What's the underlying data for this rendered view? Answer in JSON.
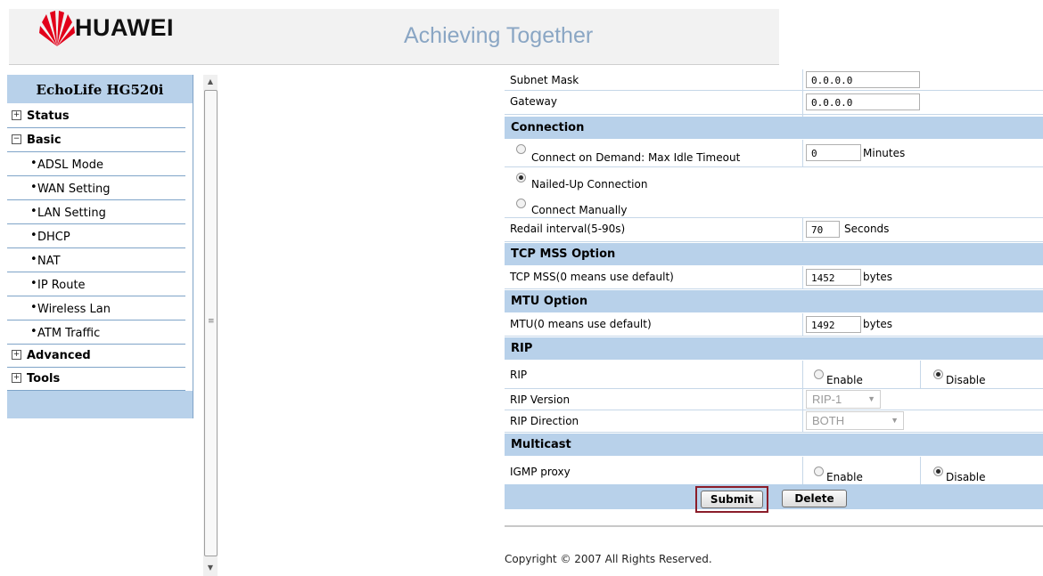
{
  "header": {
    "brand": "HUAWEI",
    "slogan": "Achieving Together"
  },
  "sidebar": {
    "title": "EchoLife HG520i",
    "items": [
      {
        "label": "Status",
        "toggle": "+"
      },
      {
        "label": "Basic",
        "toggle": "−"
      },
      {
        "label": "Advanced",
        "toggle": "+"
      },
      {
        "label": "Tools",
        "toggle": "+"
      }
    ],
    "subitems": [
      "ADSL Mode",
      "WAN Setting",
      "LAN Setting",
      "DHCP",
      "NAT",
      "IP Route",
      "Wireless Lan",
      "ATM Traffic"
    ],
    "bullet": "•"
  },
  "scrollbar": {
    "up": "▲",
    "down": "▼",
    "grip": "≡"
  },
  "form": {
    "subnet_mask": {
      "label": "Subnet Mask",
      "value": "0.0.0.0"
    },
    "gateway": {
      "label": "Gateway",
      "value": "0.0.0.0"
    },
    "connection": {
      "heading": "Connection",
      "on_demand": {
        "label": "Connect on Demand: Max Idle Timeout",
        "value": "0",
        "unit": "Minutes"
      },
      "nailed_up": "Nailed-Up Connection",
      "manual": "Connect Manually",
      "selected": "Nailed-Up Connection",
      "redial": {
        "label": "Redail interval(5-90s)",
        "value": "70",
        "unit": "Seconds"
      }
    },
    "tcp_mss": {
      "heading": "TCP MSS Option",
      "label": "TCP MSS(0 means use default)",
      "value": "1452",
      "unit": "bytes"
    },
    "mtu": {
      "heading": "MTU Option",
      "label": "MTU(0 means use default)",
      "value": "1492",
      "unit": "bytes"
    },
    "rip": {
      "heading": "RIP",
      "label": "RIP",
      "enable": "Enable",
      "disable": "Disable",
      "selected": "Disable",
      "version_label": "RIP Version",
      "version_value": "RIP-1",
      "direction_label": "RIP Direction",
      "direction_value": "BOTH",
      "dropdown_arrow": "▼"
    },
    "multicast": {
      "heading": "Multicast",
      "label": "IGMP proxy",
      "enable": "Enable",
      "disable": "Disable",
      "selected": "Disable"
    },
    "buttons": {
      "submit": "Submit",
      "delete": "Delete"
    }
  },
  "footer": {
    "copyright": "Copyright © 2007 All Rights Reserved."
  },
  "colors": {
    "band": "#b8d1ea",
    "slogan": "#8aa6c4",
    "submit_highlight": "#8b1d2a"
  }
}
